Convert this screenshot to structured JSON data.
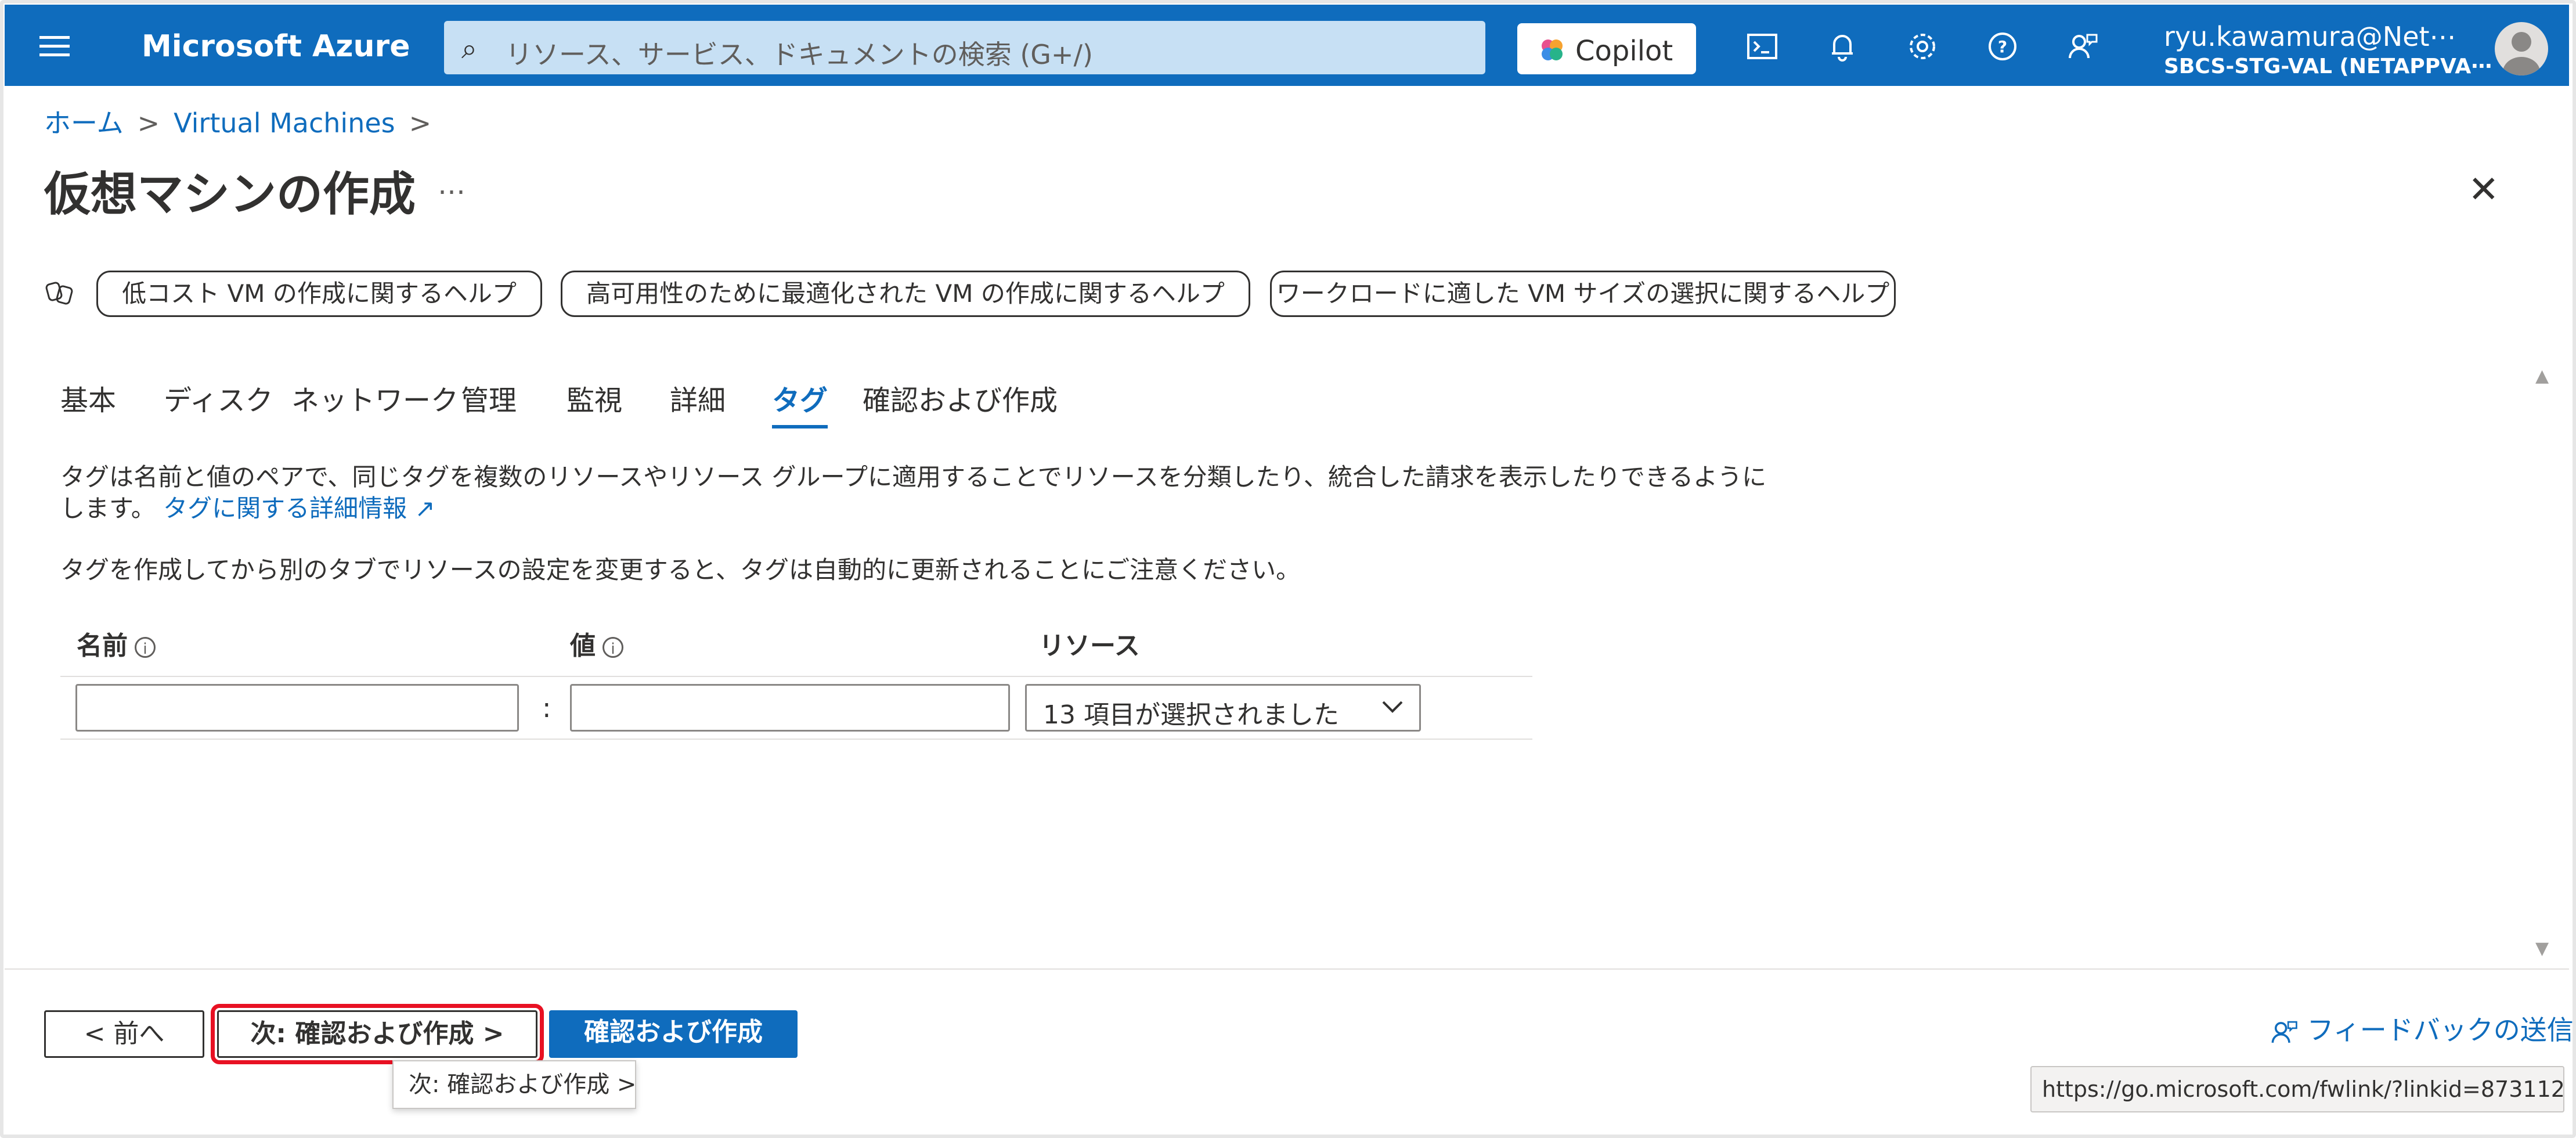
{
  "topbar": {
    "brand": "Microsoft Azure",
    "search_placeholder": "リソース、サービス、ドキュメントの検索 (G+/)",
    "copilot_label": "Copilot",
    "user_name": "ryu.kawamura@Net⋯",
    "user_org": "SBCS-STG-VAL (NETAPPVA⋯",
    "bg_color": "#0f6cbd"
  },
  "breadcrumb": {
    "home": "ホーム",
    "item1": "Virtual Machines",
    "sep": ">"
  },
  "page": {
    "title": "仮想マシンの作成",
    "more": "…",
    "close": "✕"
  },
  "help_buttons": [
    "低コスト VM の作成に関するヘルプ",
    "高可用性のために最適化された VM の作成に関するヘルプ",
    "ワークロードに適した VM サイズの選択に関するヘルプ"
  ],
  "tabs": [
    "基本",
    "ディスク",
    "ネットワーク",
    "管理",
    "監視",
    "詳細",
    "タグ",
    "確認および作成"
  ],
  "active_tab": "タグ",
  "content": {
    "desc_line1": "タグは名前と値のペアで、同じタグを複数のリソースやリソース グループに適用することでリソースを分類したり、統合した請求を表示したりできるように",
    "desc_line2": "します。",
    "learn_more": "タグに関する詳細情報",
    "note": "タグを作成してから別のタブでリソースの設定を変更すると、タグは自動的に更新されることにご注意ください。"
  },
  "table": {
    "col_name": "名前",
    "col_value": "値",
    "col_resource": "リソース",
    "separator": ":",
    "row": {
      "name": "",
      "value": "",
      "resource": "13 項目が選択されました"
    }
  },
  "footer": {
    "prev": "< 前へ",
    "next": "次: 確認および作成 >",
    "create": "確認および作成",
    "tooltip": "次: 確認および作成 >",
    "feedback": "フィードバックの送信",
    "status_url": "https://go.microsoft.com/fwlink/?linkid=873112",
    "highlight_color": "#e81123"
  }
}
